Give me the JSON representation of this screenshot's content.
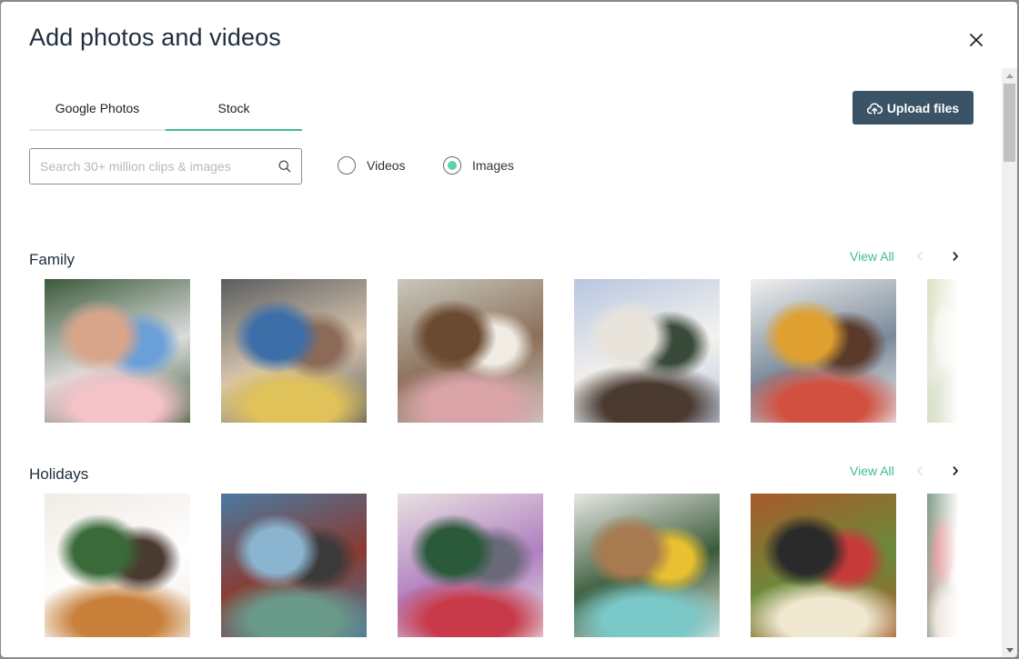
{
  "dialog": {
    "title": "Add photos and videos",
    "close_icon": "close-icon"
  },
  "tabs": [
    {
      "label": "Google Photos",
      "active": false
    },
    {
      "label": "Stock",
      "active": true
    }
  ],
  "upload": {
    "label": "Upload files",
    "icon": "cloud-upload-icon"
  },
  "search": {
    "placeholder": "Search 30+ million clips & images",
    "value": "",
    "icon": "search-icon"
  },
  "media_type": {
    "options": [
      {
        "label": "Videos",
        "selected": false
      },
      {
        "label": "Images",
        "selected": true
      }
    ]
  },
  "colors": {
    "accent": "#3dbb94",
    "radio_selected": "#5fd3a8",
    "button": "#3a5366",
    "title": "#1f2d3d"
  },
  "sections": [
    {
      "title": "Family",
      "view_all": "View All",
      "prev_enabled": false,
      "next_enabled": true,
      "thumbnails": [
        {
          "description": "Teen girl hugging grandmother on porch",
          "palette": [
            "#3a5a3a",
            "#d9a58a",
            "#f3c3c8",
            "#6a9fd8",
            "#dcdcdc"
          ]
        },
        {
          "description": "Mother and children laughing on sofa",
          "palette": [
            "#5a5d60",
            "#3d6ea8",
            "#e0c25a",
            "#8b6b58",
            "#d9c7b0"
          ]
        },
        {
          "description": "Woman working on laptop with baby on lap",
          "palette": [
            "#c8c8bc",
            "#6a4a30",
            "#d9a3a8",
            "#f0ece4",
            "#8b6f5a"
          ]
        },
        {
          "description": "Family gathering seen through open doors",
          "palette": [
            "#b8c6e0",
            "#e8e4dc",
            "#4a3a30",
            "#3a4a3a",
            "#f4f2ee"
          ]
        },
        {
          "description": "Multigenerational family taking selfie",
          "palette": [
            "#f0f0f0",
            "#e0a030",
            "#d25040",
            "#5a3a2a",
            "#7a8a9a"
          ]
        },
        {
          "description": "Landscape with trees and water (partially visible)",
          "palette": [
            "#c8d0a0",
            "#e8ead8",
            "#b8c4a0",
            "#f0f0e8",
            "#d8dcc8"
          ]
        }
      ]
    },
    {
      "title": "Holidays",
      "view_all": "View All",
      "prev_enabled": false,
      "next_enabled": true,
      "thumbnails": [
        {
          "description": "Family holiday dinner with Christmas tree",
          "palette": [
            "#f0ebe4",
            "#3a6a3a",
            "#c8803a",
            "#4a3a30",
            "#ffffff"
          ]
        },
        {
          "description": "Grandfather laughing with toddler on couch",
          "palette": [
            "#4a7aa0",
            "#8ab4d0",
            "#6a9a8a",
            "#3a3a3a",
            "#8a3a30"
          ]
        },
        {
          "description": "Girl opening Christmas present",
          "palette": [
            "#e8e0e0",
            "#2a5a3a",
            "#c83a4a",
            "#6a6a7a",
            "#b080c0"
          ]
        },
        {
          "description": "Family eating at kitchen table",
          "palette": [
            "#e8e8e4",
            "#a87a50",
            "#7ac8c8",
            "#e8c030",
            "#3a5a3a"
          ]
        },
        {
          "description": "Overhead view of holiday food on wooden table",
          "palette": [
            "#a85a2a",
            "#2a2a2a",
            "#f0e8d0",
            "#c83a3a",
            "#6a8a3a"
          ]
        },
        {
          "description": "Christmas tree partially visible",
          "palette": [
            "#3a6a4a",
            "#c83a3a",
            "#d8c8b8",
            "#f0f0f0",
            "#8a6a5a"
          ]
        }
      ]
    }
  ]
}
